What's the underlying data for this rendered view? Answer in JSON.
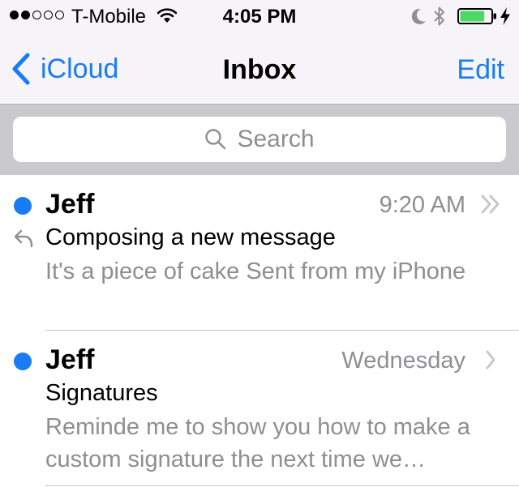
{
  "status_bar": {
    "carrier": "T-Mobile",
    "time": "4:05 PM",
    "signal_bars_filled": 2,
    "signal_bars_total": 5,
    "battery_level": 0.8,
    "icons": [
      "wifi-icon",
      "moon-icon",
      "bluetooth-icon",
      "battery-icon",
      "charging-bolt-icon"
    ]
  },
  "nav": {
    "back_label": "iCloud",
    "title": "Inbox",
    "edit_label": "Edit"
  },
  "search": {
    "placeholder": "Search"
  },
  "messages": [
    {
      "sender": "Jeff",
      "date": "9:20 AM",
      "subject": "Composing a new message",
      "preview": "It's a piece of cake Sent from my iPhone",
      "unread": true,
      "replied": true,
      "thread": true
    },
    {
      "sender": "Jeff",
      "date": "Wednesday",
      "subject": "Signatures",
      "preview": "Reminde me to show you how to make a custom signature the next time we…",
      "unread": true,
      "replied": false,
      "thread": false
    }
  ],
  "colors": {
    "accent": "#1a7cf5",
    "bar_background": "#f6f4f8",
    "search_background": "#c9c9ce",
    "secondary_text": "#8e8e93",
    "battery_fill": "#4cd964"
  }
}
